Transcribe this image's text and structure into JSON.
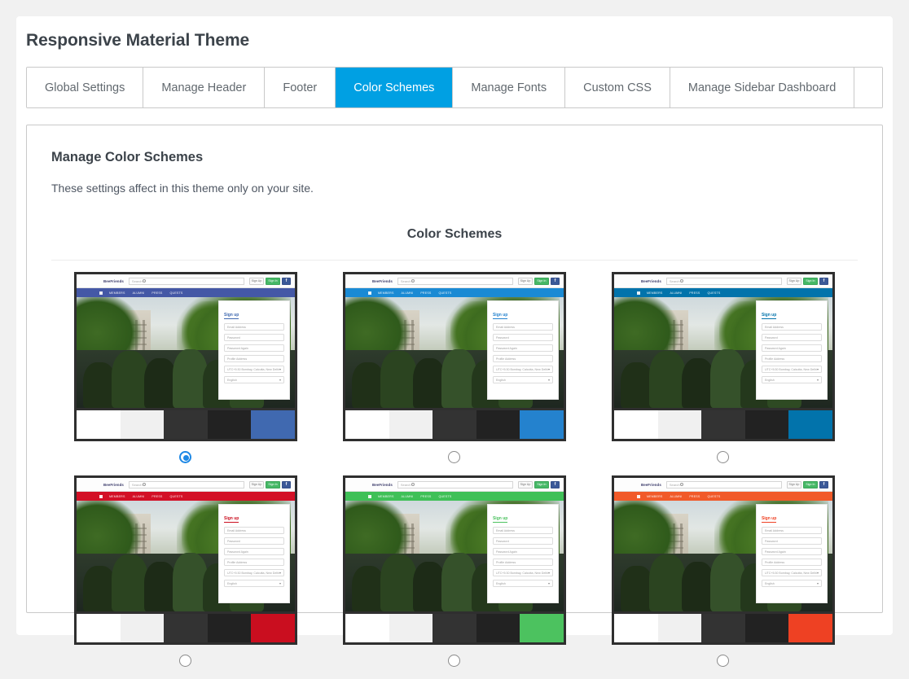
{
  "page": {
    "title": "Responsive Material Theme",
    "background_color": "#f1f1f1",
    "card_color": "#ffffff"
  },
  "tabs": {
    "active_index": 3,
    "active_color": "#00a0e3",
    "items": [
      {
        "label": "Global Settings"
      },
      {
        "label": "Manage Header"
      },
      {
        "label": "Footer"
      },
      {
        "label": "Color Schemes"
      },
      {
        "label": "Manage Fonts"
      },
      {
        "label": "Custom CSS"
      },
      {
        "label": "Manage Sidebar Dashboard"
      }
    ]
  },
  "panel": {
    "heading": "Manage Color Schemes",
    "description": "These settings affect in this theme only on your site.",
    "section_title": "Color Schemes"
  },
  "preview": {
    "logo": "BeeFriends",
    "search_placeholder": "Search",
    "buttons": {
      "sign_up": "Sign Up",
      "sign_in": "Sign In",
      "facebook": "f"
    },
    "nav_items": [
      "MEMBERS",
      "ALUMNI",
      "PRESS",
      "QUESTS"
    ],
    "signup": {
      "title": "Sign up",
      "fields": [
        "Email Address",
        "Password",
        "Password Again",
        "Profile Address"
      ],
      "selects": [
        "UTC+5:30 Bombay, Calcutta, New Delhi",
        "English"
      ]
    }
  },
  "schemes": [
    {
      "name": "scheme-1",
      "selected": true,
      "accent": "#4069b0",
      "navbar": "#4458a6",
      "swatches": [
        "#ffffff",
        "#f0f0f0",
        "#333333",
        "#222222",
        "#4069b0"
      ]
    },
    {
      "name": "scheme-2",
      "selected": false,
      "accent": "#2482ce",
      "navbar": "#1a8ad4",
      "swatches": [
        "#ffffff",
        "#f0f0f0",
        "#333333",
        "#222222",
        "#2482ce"
      ]
    },
    {
      "name": "scheme-3",
      "selected": false,
      "accent": "#0273ab",
      "navbar": "#0273ab",
      "swatches": [
        "#ffffff",
        "#f0f0f0",
        "#333333",
        "#222222",
        "#0273ab"
      ]
    },
    {
      "name": "scheme-4",
      "selected": false,
      "accent": "#ca0e1f",
      "navbar": "#d31026",
      "swatches": [
        "#ffffff",
        "#f0f0f0",
        "#333333",
        "#222222",
        "#ca0e1f"
      ]
    },
    {
      "name": "scheme-5",
      "selected": false,
      "accent": "#4cc25f",
      "navbar": "#3fc057",
      "swatches": [
        "#ffffff",
        "#f0f0f0",
        "#333333",
        "#222222",
        "#4cc25f"
      ]
    },
    {
      "name": "scheme-6",
      "selected": false,
      "accent": "#ee4123",
      "navbar": "#f15a29",
      "swatches": [
        "#ffffff",
        "#f0f0f0",
        "#333333",
        "#222222",
        "#ee4123"
      ]
    }
  ]
}
